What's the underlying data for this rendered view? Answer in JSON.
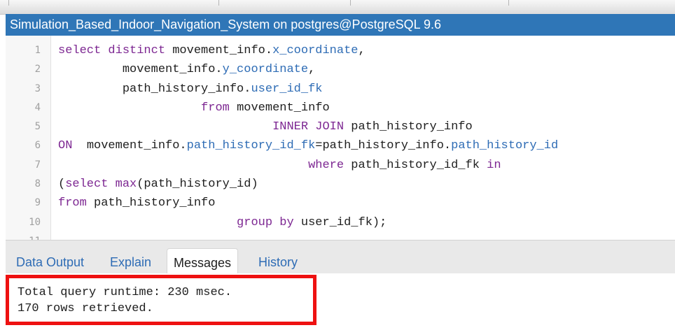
{
  "window": {
    "title": "Simulation_Based_Indoor_Navigation_System on postgres@PostgreSQL 9.6"
  },
  "editor": {
    "lines": [
      {
        "number": "1",
        "tokens": [
          [
            "kw",
            "select distinct "
          ],
          [
            "plain",
            "movement_info."
          ],
          [
            "field",
            "x_coordinate"
          ],
          [
            "plain",
            ","
          ]
        ]
      },
      {
        "number": "2",
        "tokens": [
          [
            "plain",
            "         movement_info."
          ],
          [
            "field",
            "y_coordinate"
          ],
          [
            "plain",
            ","
          ]
        ]
      },
      {
        "number": "3",
        "tokens": [
          [
            "plain",
            "         path_history_info."
          ],
          [
            "field",
            "user_id_fk"
          ]
        ]
      },
      {
        "number": "4",
        "tokens": [
          [
            "plain",
            "                    "
          ],
          [
            "kw",
            "from "
          ],
          [
            "plain",
            "movement_info"
          ]
        ]
      },
      {
        "number": "5",
        "tokens": [
          [
            "plain",
            "                              "
          ],
          [
            "kw",
            "INNER JOIN "
          ],
          [
            "plain",
            "path_history_info"
          ]
        ]
      },
      {
        "number": "6",
        "tokens": [
          [
            "kw",
            "ON  "
          ],
          [
            "plain",
            "movement_info."
          ],
          [
            "field",
            "path_history_id_fk"
          ],
          [
            "plain",
            "=path_history_info."
          ],
          [
            "field",
            "path_history_id"
          ]
        ]
      },
      {
        "number": "7",
        "tokens": [
          [
            "plain",
            "                                   "
          ],
          [
            "kw",
            "where "
          ],
          [
            "plain",
            "path_history_id_fk "
          ],
          [
            "kw",
            "in"
          ]
        ]
      },
      {
        "number": "8",
        "tokens": [
          [
            "plain",
            "("
          ],
          [
            "kw",
            "select max"
          ],
          [
            "plain",
            "(path_history_id)"
          ]
        ]
      },
      {
        "number": "9",
        "tokens": [
          [
            "kw",
            "from "
          ],
          [
            "plain",
            "path_history_info"
          ]
        ]
      },
      {
        "number": "10",
        "tokens": [
          [
            "plain",
            "                         "
          ],
          [
            "kw",
            "group by "
          ],
          [
            "plain",
            "user_id_fk);"
          ]
        ]
      },
      {
        "number": "11",
        "tokens": []
      }
    ]
  },
  "output_tabs": [
    {
      "label": "Data Output",
      "active": false
    },
    {
      "label": "Explain",
      "active": false
    },
    {
      "label": "Messages",
      "active": true
    },
    {
      "label": "History",
      "active": false
    }
  ],
  "messages": {
    "runtime": "Total query runtime: 230 msec.",
    "rows": "170 rows retrieved."
  },
  "colors": {
    "titlebar": "#2f76b7",
    "keyword": "#7d2792",
    "field": "#2e6cb5",
    "highlight": "#ee1111"
  }
}
